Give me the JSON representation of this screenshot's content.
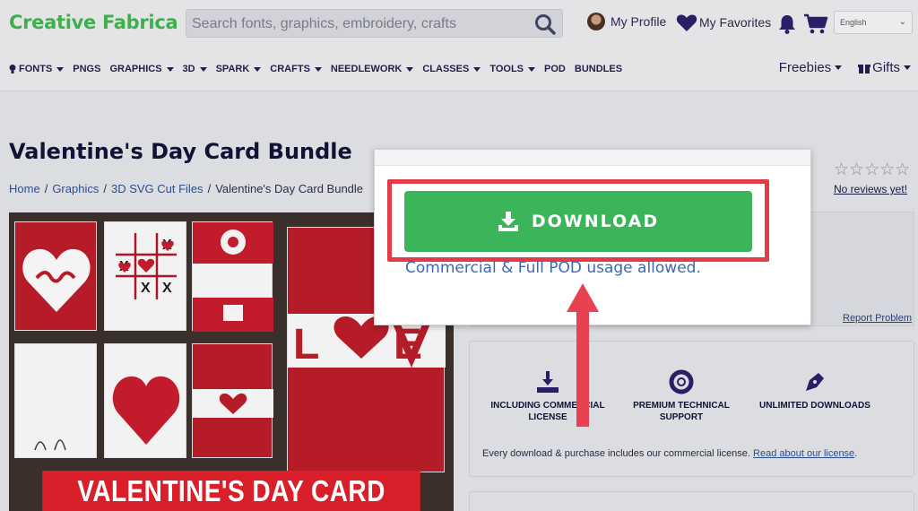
{
  "header": {
    "logo": "Creative Fabrica",
    "search_placeholder": "Search fonts, graphics, embroidery, crafts",
    "profile_label": "My Profile",
    "favorites_label": "My Favorites",
    "language": "English"
  },
  "nav": {
    "items": [
      {
        "label": "FONTS",
        "dropdown": true,
        "icon": "bulb-icon"
      },
      {
        "label": "PNGS",
        "dropdown": false
      },
      {
        "label": "GRAPHICS",
        "dropdown": true
      },
      {
        "label": "3D",
        "dropdown": true
      },
      {
        "label": "SPARK",
        "dropdown": true
      },
      {
        "label": "CRAFTS",
        "dropdown": true
      },
      {
        "label": "NEEDLEWORK",
        "dropdown": true
      },
      {
        "label": "CLASSES",
        "dropdown": true
      },
      {
        "label": "TOOLS",
        "dropdown": true
      },
      {
        "label": "POD",
        "dropdown": false
      },
      {
        "label": "BUNDLES",
        "dropdown": false
      }
    ],
    "freebies": "Freebies",
    "gifts": "Gifts"
  },
  "product": {
    "title": "Valentine's Day Card Bundle",
    "breadcrumb": [
      "Home",
      "Graphics",
      "3D SVG Cut Files",
      "Valentine's Day Card Bundle"
    ],
    "banner_text": "VALENTINE'S DAY CARD BUNDLE",
    "no_reviews": "No reviews yet!",
    "report_problem": "Report Problem",
    "rating_stars": 0
  },
  "popup": {
    "download_label": "DOWNLOAD",
    "usage_text": "Commercial & Full POD usage allowed."
  },
  "license": {
    "features": [
      {
        "label": "INCLUDING COMMERCIAL LICENSE",
        "icon": "download-tray-icon"
      },
      {
        "label": "PREMIUM TECHNICAL SUPPORT",
        "icon": "lifebuoy-icon"
      },
      {
        "label": "UNLIMITED DOWNLOADS",
        "icon": "pen-nib-icon"
      }
    ],
    "note_text": "Every download & purchase includes our commercial license.",
    "note_link": "Read about our license",
    "note_end": "."
  },
  "colors": {
    "brand_green": "#3cb04b",
    "download_green": "#3cb45a",
    "highlight_red": "#e33b48",
    "navy": "#1f1f4a"
  }
}
